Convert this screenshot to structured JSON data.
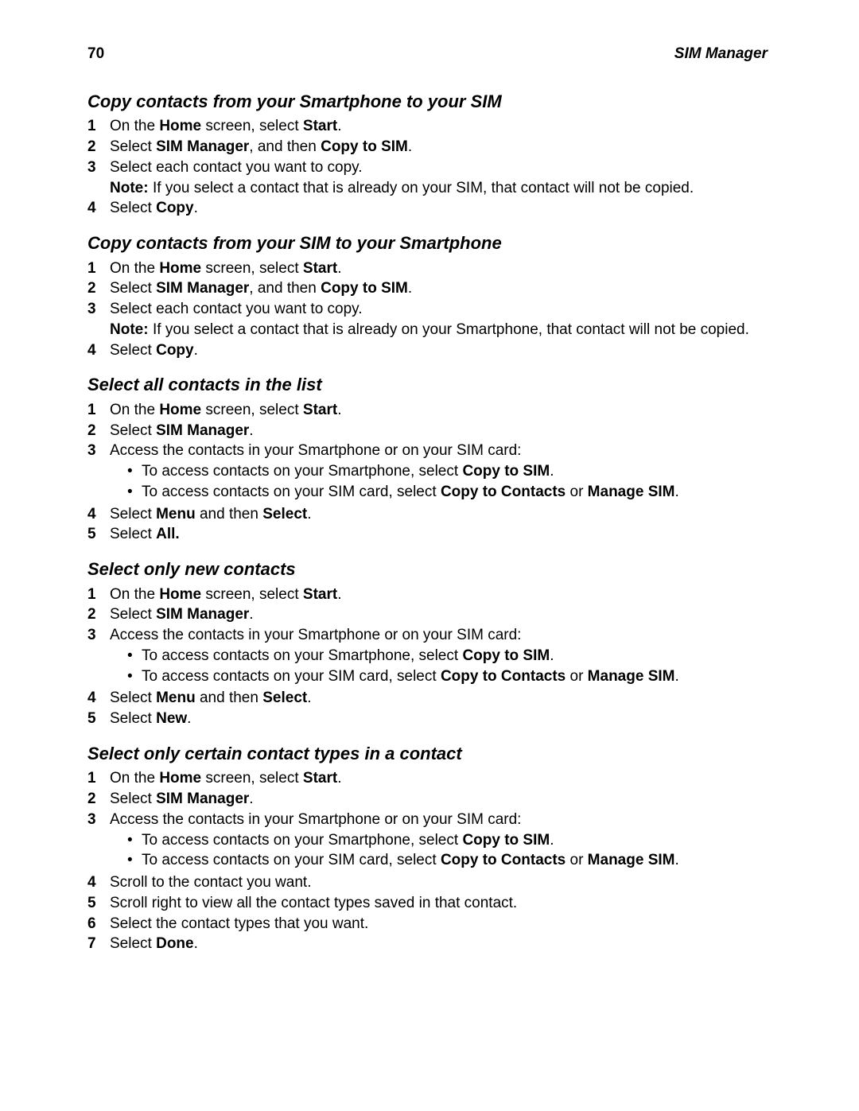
{
  "running_head": {
    "page_number": "70",
    "chapter": "SIM Manager"
  },
  "sec1": {
    "title": "Copy contacts from your Smartphone to your SIM",
    "s1": {
      "pre": "On the ",
      "b1": "Home",
      "mid": " screen, select ",
      "b2": "Start",
      "post": "."
    },
    "s2": {
      "pre": "Select ",
      "b1": "SIM Manager",
      "mid": ", and then ",
      "b2": "Copy to SIM",
      "post": "."
    },
    "s3": {
      "text": "Select each contact you want to copy."
    },
    "note_label": "Note:",
    "note_text": "If you select a contact that is already on your SIM, that contact will not be copied.",
    "s4": {
      "pre": "Select ",
      "b1": "Copy",
      "post": "."
    }
  },
  "sec2": {
    "title": "Copy contacts from your SIM to your Smartphone",
    "s1": {
      "pre": "On the ",
      "b1": "Home",
      "mid": " screen, select ",
      "b2": "Start",
      "post": "."
    },
    "s2": {
      "pre": "Select ",
      "b1": "SIM Manager",
      "mid": ", and then ",
      "b2": "Copy to SIM",
      "post": "."
    },
    "s3": {
      "text": "Select each contact you want to copy."
    },
    "note_label": "Note:",
    "note_text": "If you select a contact that is already on your Smartphone, that contact will not be copied.",
    "s4": {
      "pre": "Select ",
      "b1": "Copy",
      "post": "."
    }
  },
  "sec3": {
    "title": "Select all contacts in the list",
    "s1": {
      "pre": "On the ",
      "b1": "Home",
      "mid": " screen, select ",
      "b2": "Start",
      "post": "."
    },
    "s2": {
      "pre": "Select ",
      "b1": "SIM Manager",
      "post": "."
    },
    "s3": {
      "text": "Access the contacts in your Smartphone or on your SIM card:"
    },
    "b1": {
      "pre": "To access contacts on your Smartphone, select ",
      "b": "Copy to SIM",
      "post": "."
    },
    "b2": {
      "pre": "To access contacts on your SIM card, select ",
      "ba": "Copy to Contacts",
      "mid": " or ",
      "bb": "Manage SIM",
      "post": "."
    },
    "s4": {
      "pre": "Select ",
      "ba": "Menu",
      "mid": " and then ",
      "bb": "Select",
      "post": "."
    },
    "s5": {
      "pre": "Select ",
      "b": "All."
    }
  },
  "sec4": {
    "title": "Select only new contacts",
    "s1": {
      "pre": "On the ",
      "b1": "Home",
      "mid": " screen, select ",
      "b2": "Start",
      "post": "."
    },
    "s2": {
      "pre": "Select ",
      "b1": "SIM Manager",
      "post": "."
    },
    "s3": {
      "text": "Access the contacts in your Smartphone or on your SIM card:"
    },
    "b1": {
      "pre": "To access contacts on your Smartphone, select ",
      "b": "Copy to SIM",
      "post": "."
    },
    "b2": {
      "pre": "To access contacts on your SIM card, select ",
      "ba": "Copy to Contacts",
      "mid": " or ",
      "bb": "Manage SIM",
      "post": "."
    },
    "s4": {
      "pre": "Select ",
      "ba": "Menu",
      "mid": " and then ",
      "bb": "Select",
      "post": "."
    },
    "s5": {
      "pre": "Select ",
      "b": "New",
      "post": "."
    }
  },
  "sec5": {
    "title": "Select only certain contact types in a contact",
    "s1": {
      "pre": "On the ",
      "b1": "Home",
      "mid": " screen, select ",
      "b2": "Start",
      "post": "."
    },
    "s2": {
      "pre": "Select ",
      "b1": "SIM Manager",
      "post": "."
    },
    "s3": {
      "text": "Access the contacts in your Smartphone or on your SIM card:"
    },
    "b1": {
      "pre": "To access contacts on your Smartphone, select ",
      "b": "Copy to SIM",
      "post": "."
    },
    "b2": {
      "pre": "To access contacts on your SIM card, select ",
      "ba": "Copy to Contacts",
      "mid": " or ",
      "bb": "Manage SIM",
      "post": "."
    },
    "s4": {
      "text": "Scroll to the contact you want."
    },
    "s5": {
      "text": "Scroll right to view all the contact types saved in that contact."
    },
    "s6": {
      "text": "Select the contact types that you want."
    },
    "s7": {
      "pre": "Select ",
      "b": "Done",
      "post": "."
    }
  }
}
